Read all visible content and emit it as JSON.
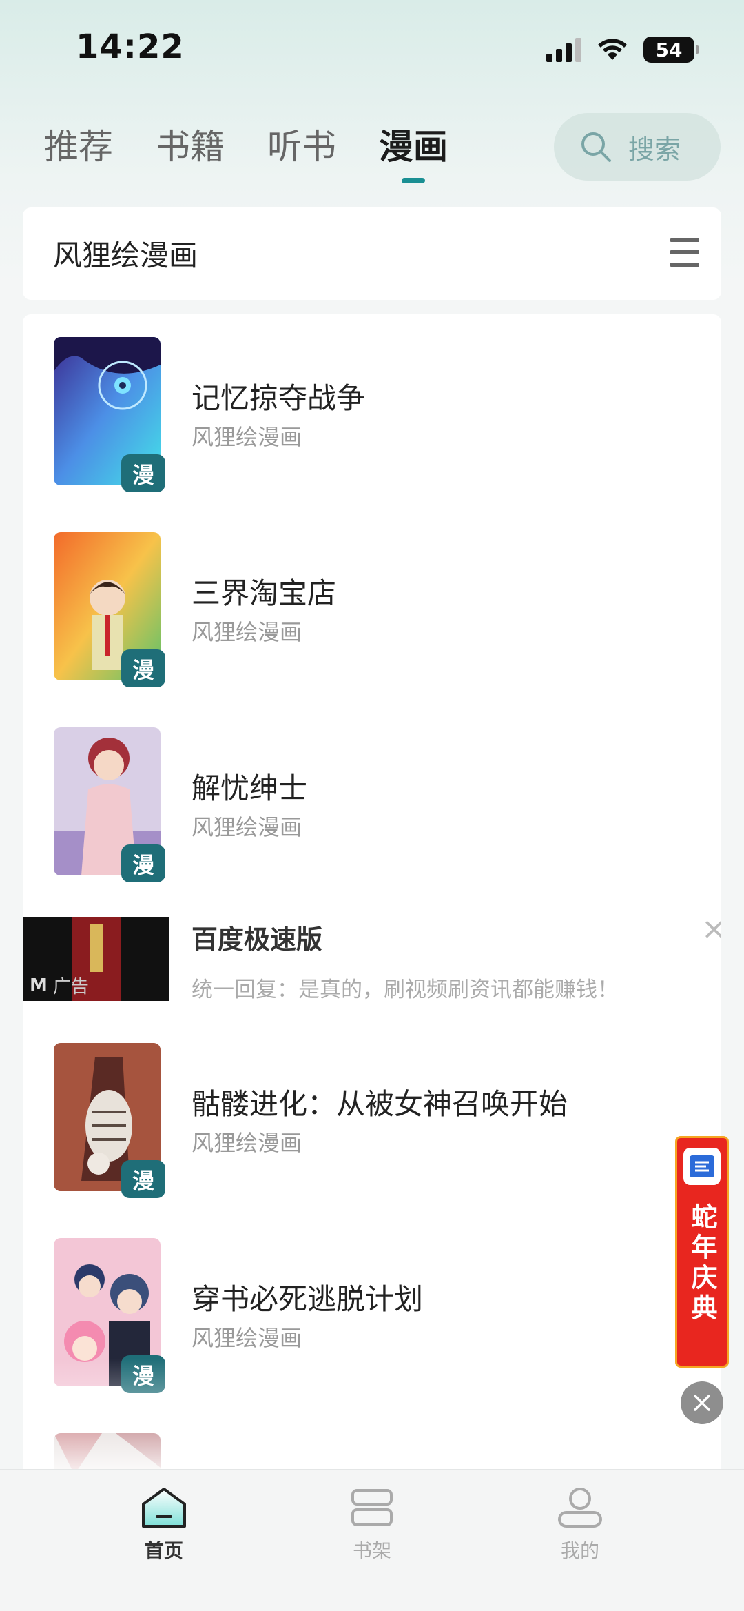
{
  "status_bar": {
    "time": "14:22",
    "battery": "54"
  },
  "tabs": [
    {
      "label": "推荐",
      "active": false
    },
    {
      "label": "书籍",
      "active": false
    },
    {
      "label": "听书",
      "active": false
    },
    {
      "label": "漫画",
      "active": true
    }
  ],
  "search": {
    "placeholder": "搜索"
  },
  "source": {
    "title": "风狸绘漫画"
  },
  "books": [
    {
      "title": "记忆掠夺战争",
      "source": "风狸绘漫画",
      "badge": "漫"
    },
    {
      "title": "三界淘宝店",
      "source": "风狸绘漫画",
      "badge": "漫"
    },
    {
      "title": "解忧绅士",
      "source": "风狸绘漫画",
      "badge": "漫"
    },
    {
      "title": "骷髅进化：从被女神召唤开始",
      "source": "风狸绘漫画",
      "badge": "漫"
    },
    {
      "title": "穿书必死逃脱计划",
      "source": "风狸绘漫画",
      "badge": "漫"
    }
  ],
  "ad": {
    "tag": "广告",
    "title": "百度极速版",
    "description": "统一回复：是真的，刷视频刷资讯都能赚钱！"
  },
  "promo": {
    "text": "蛇年庆典"
  },
  "bottom_nav": [
    {
      "label": "首页",
      "active": true
    },
    {
      "label": "书架",
      "active": false
    },
    {
      "label": "我的",
      "active": false
    }
  ],
  "colors": {
    "accent": "#1a8f93",
    "badge": "#1f6e78",
    "promo": "#e8261f"
  }
}
